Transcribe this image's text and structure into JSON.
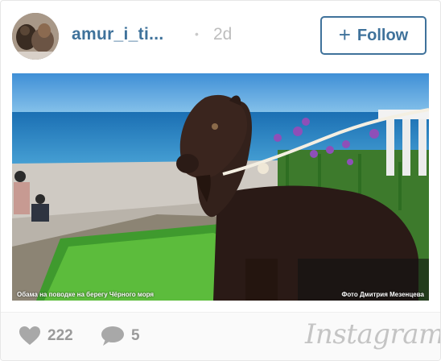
{
  "post": {
    "username": "amur_i_ti...",
    "separator": "•",
    "time": "2d",
    "follow_label": "Follow",
    "follow_icon": "plus-icon",
    "image_alt_subject": "goat-on-leash",
    "caption_left": "Обама на поводке на берегу Чёрного моря",
    "caption_right": "Фото Дмитрия Мезенцева"
  },
  "footer": {
    "likes": "222",
    "like_icon": "heart-icon",
    "comments": "5",
    "comment_icon": "speech-bubble-icon",
    "logo_text": "Instagram"
  },
  "colors": {
    "username": "#3f729b",
    "follow_border": "#3f729b",
    "muted": "#9a9a9a"
  }
}
